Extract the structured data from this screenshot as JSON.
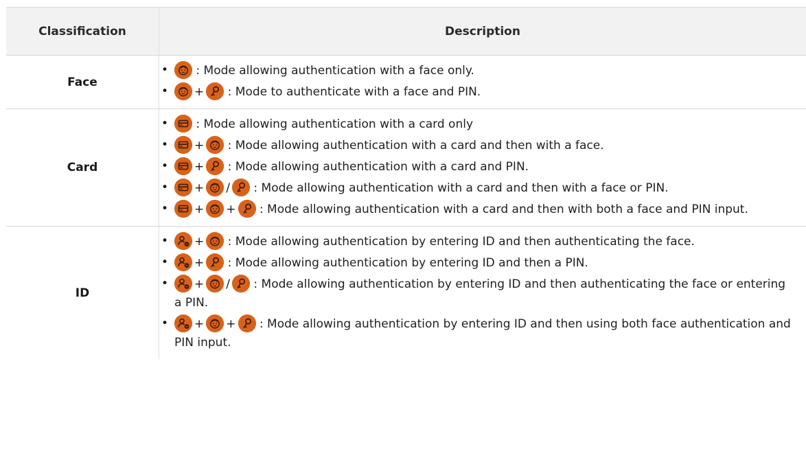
{
  "header": {
    "classification": "Classification",
    "description": "Description"
  },
  "colors": {
    "icon_fill": "#d9621a",
    "icon_line": "#3a1a05",
    "header_bg": "#f2f2f2",
    "border": "#d6d6d6"
  },
  "operators": {
    "plus": "+",
    "or": "/"
  },
  "rows": [
    {
      "classification": "Face",
      "items": [
        {
          "icons": [
            "face-icon"
          ],
          "text": ": Mode allowing authentication with a face only."
        },
        {
          "icons": [
            "face-icon",
            "+",
            "pin-icon"
          ],
          "text": ": Mode to authenticate with a face and PIN."
        }
      ]
    },
    {
      "classification": "Card",
      "items": [
        {
          "icons": [
            "card-icon"
          ],
          "text": ": Mode allowing authentication with a card only"
        },
        {
          "icons": [
            "card-icon",
            "+",
            "face-icon"
          ],
          "text": ": Mode allowing authentication with a card and then with a face."
        },
        {
          "icons": [
            "card-icon",
            "+",
            "pin-icon"
          ],
          "text": ": Mode allowing authentication with a card and PIN."
        },
        {
          "icons": [
            "card-icon",
            "+",
            "face-icon",
            "/",
            "pin-icon"
          ],
          "text": ": Mode allowing authentication with a card and then with a face or PIN."
        },
        {
          "icons": [
            "card-icon",
            "+",
            "face-icon",
            "+",
            "pin-icon"
          ],
          "text": ": Mode allowing authentication with a card and then with both a face and PIN input."
        }
      ]
    },
    {
      "classification": "ID",
      "items": [
        {
          "icons": [
            "id-icon",
            "+",
            "face-icon"
          ],
          "text": ": Mode allowing authentication by entering ID and then authenticating the face."
        },
        {
          "icons": [
            "id-icon",
            "+",
            "pin-icon"
          ],
          "text": ": Mode allowing authentication by entering ID and then a PIN."
        },
        {
          "icons": [
            "id-icon",
            "+",
            "face-icon",
            "/",
            "pin-icon"
          ],
          "text": ": Mode allowing authentication by entering ID and then authenticating the face or entering a PIN."
        },
        {
          "icons": [
            "id-icon",
            "+",
            "face-icon",
            "+",
            "pin-icon"
          ],
          "text": ": Mode allowing authentication by entering ID and then using both face authentication and PIN input."
        }
      ]
    }
  ]
}
